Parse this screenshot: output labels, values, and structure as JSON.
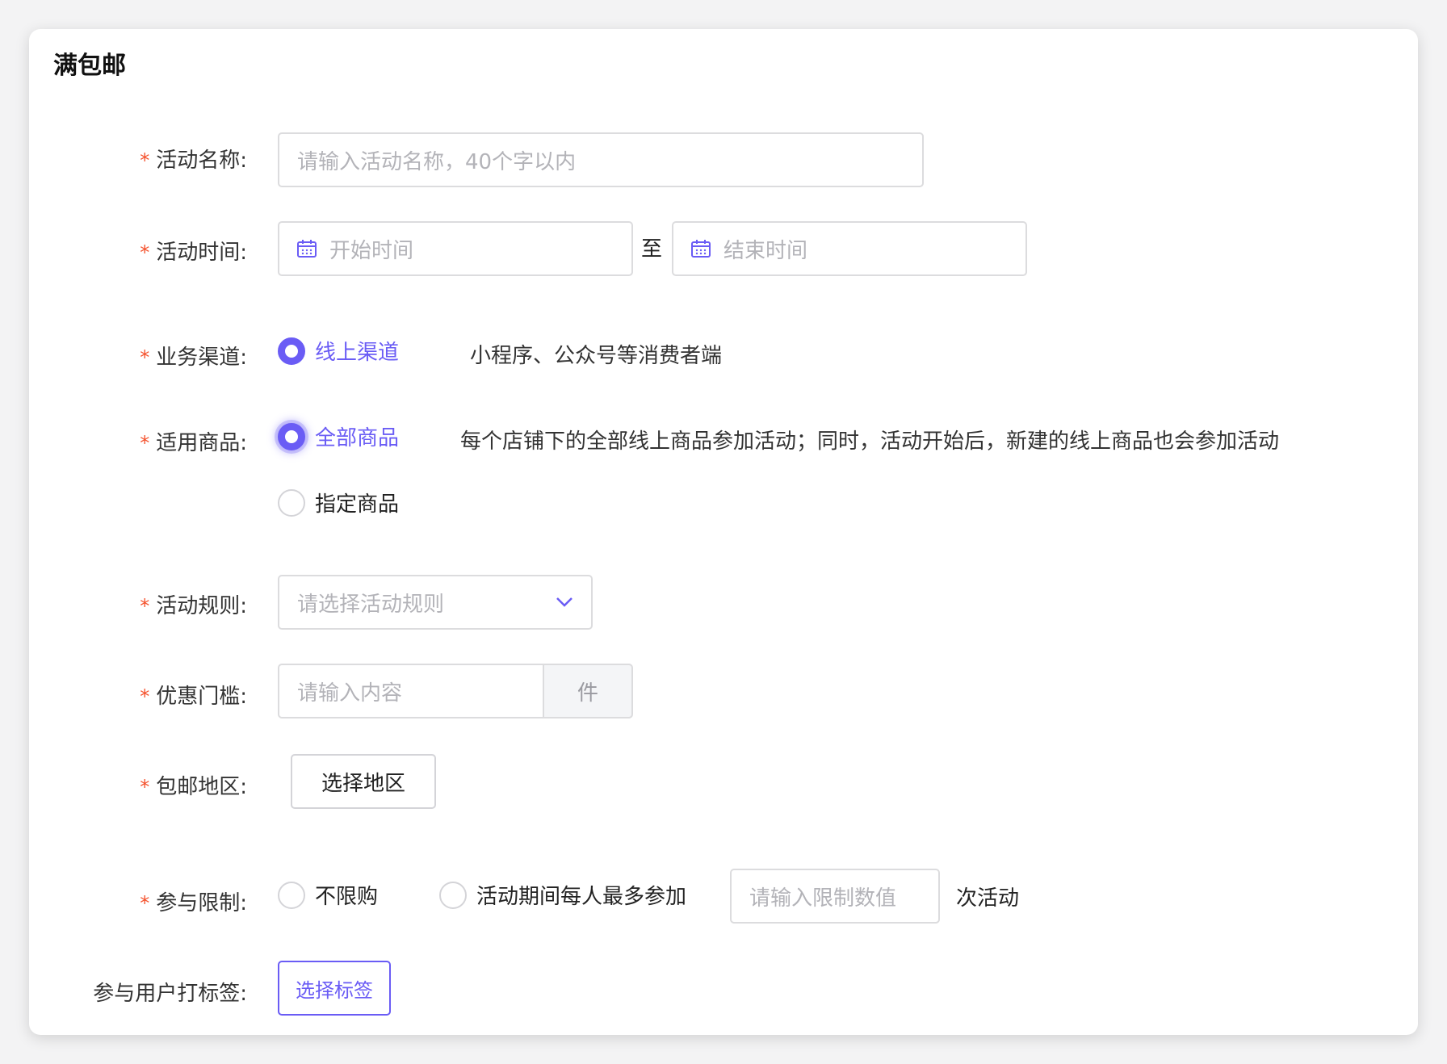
{
  "page_title": "满包邮",
  "fields": {
    "activity_name": {
      "label": "活动名称:",
      "placeholder": "请输入活动名称，40个字以内"
    },
    "activity_time": {
      "label": "活动时间:",
      "start_placeholder": "开始时间",
      "separator": "至",
      "end_placeholder": "结束时间"
    },
    "business_channel": {
      "label": "业务渠道:",
      "option": "线上渠道",
      "description": "小程序、公众号等消费者端"
    },
    "applicable_products": {
      "label": "适用商品:",
      "options": [
        "全部商品",
        "指定商品"
      ],
      "selected": "全部商品",
      "description": "每个店铺下的全部线上商品参加活动；同时，活动开始后，新建的线上商品也会参加活动"
    },
    "activity_rule": {
      "label": "活动规则:",
      "placeholder": "请选择活动规则"
    },
    "threshold": {
      "label": "优惠门槛:",
      "placeholder": "请输入内容",
      "unit": "件"
    },
    "free_shipping_region": {
      "label": "包邮地区:",
      "button": "选择地区"
    },
    "participation_limit": {
      "label": "参与限制:",
      "option_unlimited": "不限购",
      "option_limited": "活动期间每人最多参加",
      "placeholder": "请输入限制数值",
      "suffix": "次活动"
    },
    "user_tag": {
      "label": "参与用户打标签:",
      "button": "选择标签"
    }
  },
  "colors": {
    "accent": "#6a5cf5",
    "required": "#f5522d",
    "border": "#dcdcde",
    "placeholder": "#b3b3b8"
  },
  "icons": [
    "calendar-icon",
    "chevron-down-icon"
  ]
}
